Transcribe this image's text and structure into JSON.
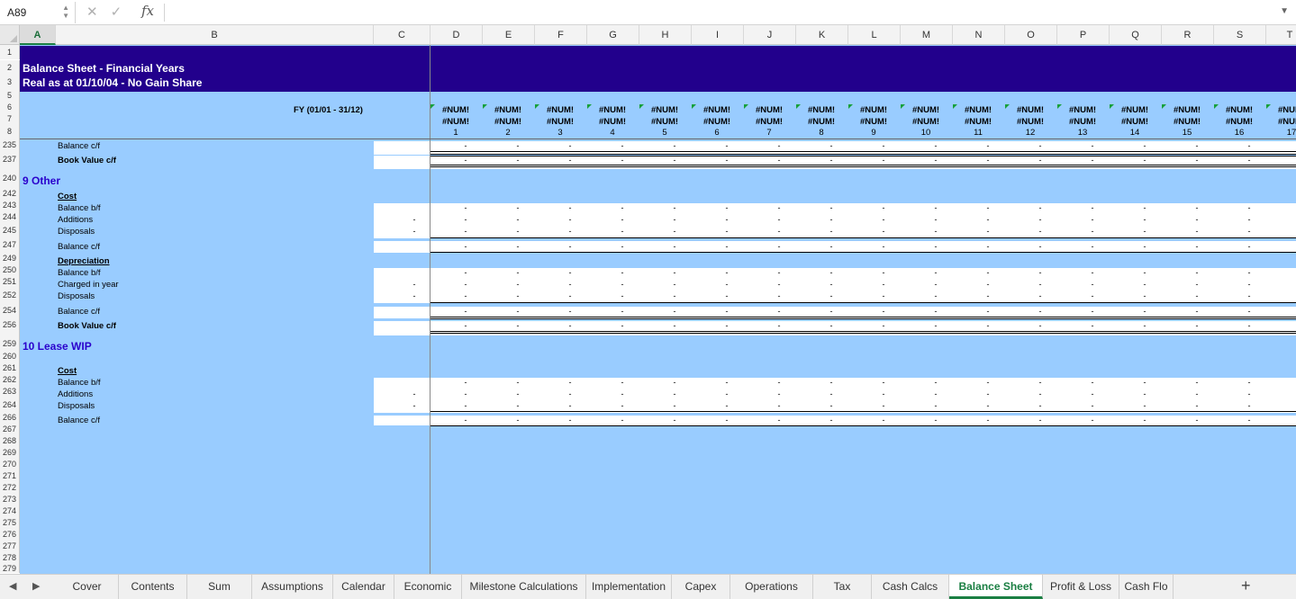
{
  "formula_bar": {
    "cell_ref": "A89",
    "fx_label": "fx",
    "formula": ""
  },
  "columns": [
    "A",
    "B",
    "C",
    "D",
    "E",
    "F",
    "G",
    "H",
    "I",
    "J",
    "K",
    "L",
    "M",
    "N",
    "O",
    "P",
    "Q",
    "R",
    "S",
    "T"
  ],
  "selected_column": "A",
  "rows": [
    "1",
    "2",
    "3",
    "5",
    "6",
    "7",
    "8",
    "235",
    "237",
    "240",
    "242",
    "243",
    "244",
    "245",
    "247",
    "249",
    "250",
    "251",
    "252",
    "254",
    "256",
    "259",
    "260",
    "261",
    "262",
    "263",
    "264",
    "266",
    "267",
    "268",
    "269",
    "270",
    "271",
    "272",
    "273",
    "274",
    "275",
    "276",
    "277",
    "278",
    "279"
  ],
  "header": {
    "title1": "Balance Sheet - Financial Years",
    "title2": "Real as at 01/10/04 - No Gain Share",
    "fy_label": "FY  (01/01 -  31/12)",
    "error_value": "#NUM!",
    "period_numbers": [
      "1",
      "2",
      "3",
      "4",
      "5",
      "6",
      "7",
      "8",
      "9",
      "10",
      "11",
      "12",
      "13",
      "14",
      "15",
      "16",
      "17"
    ]
  },
  "labels": {
    "r235": "Balance c/f",
    "r237": "Book Value c/f",
    "sec9": "9 Other",
    "r242": "Cost",
    "r243": "Balance b/f",
    "r244": "Additions",
    "r245": "Disposals",
    "r247": "Balance c/f",
    "r249": "Depreciation",
    "r250": "Balance b/f",
    "r251": "Charged in year",
    "r252": "Disposals",
    "r254": "Balance c/f",
    "r256": "Book Value c/f",
    "sec10": "10 Lease WIP",
    "r261": "Cost",
    "r262": "Balance b/f",
    "r263": "Additions",
    "r264": "Disposals",
    "r266": "Balance c/f"
  },
  "dash": "-",
  "tabs": [
    "Cover",
    "Contents",
    "Sum",
    "Assumptions",
    "Calendar",
    "Economic",
    "Milestone Calculations",
    "Implementation",
    "Capex",
    "Operations",
    "Tax",
    "Cash Calcs",
    "Balance Sheet",
    "Profit & Loss",
    "Cash Flo"
  ],
  "active_tab": "Balance Sheet",
  "colors": {
    "navy": "#22008c",
    "light_blue": "#99ccff",
    "section_text": "#2a00cc",
    "active_tab": "#1b7f43"
  }
}
